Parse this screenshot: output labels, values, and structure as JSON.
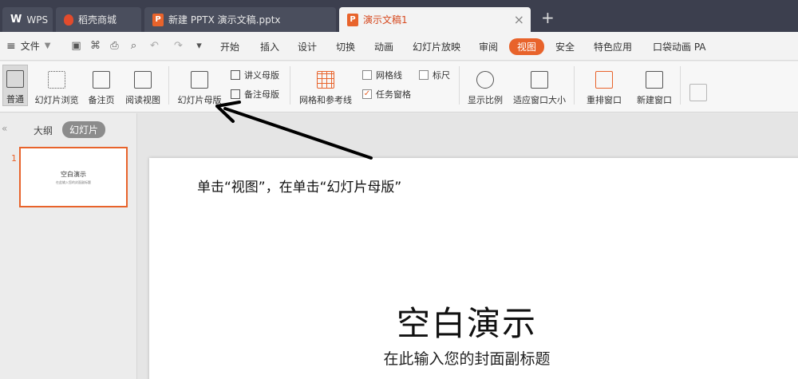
{
  "tabs": [
    {
      "label": "WPS"
    },
    {
      "label": "稻壳商城"
    },
    {
      "label": "新建 PPTX 演示文稿.pptx"
    },
    {
      "label": "演示文稿1"
    }
  ],
  "new_tab_symbol": "+",
  "menu": {
    "file": "文件",
    "items": [
      "开始",
      "插入",
      "设计",
      "切换",
      "动画",
      "幻灯片放映",
      "审阅",
      "视图",
      "安全",
      "特色应用",
      "口袋动画 PA"
    ],
    "active": "视图"
  },
  "ribbon": {
    "normal": "普通",
    "slide_sorter": "幻灯片浏览",
    "notes_page": "备注页",
    "reading_view": "阅读视图",
    "slide_master": "幻灯片母版",
    "handout_master": "讲义母版",
    "notes_master": "备注母版",
    "grid_guides": "网格和参考线",
    "gridlines": "网格线",
    "ruler": "标尺",
    "task_pane": "任务窗格",
    "zoom": "显示比例",
    "fit_window": "适应窗口大小",
    "arrange_windows": "重排窗口",
    "new_window": "新建窗口"
  },
  "left_panel": {
    "outline": "大纲",
    "slides": "幻灯片",
    "slide_number": "1",
    "thumb_title": "空白演示",
    "thumb_subtitle": "在此输入您的封面副标题"
  },
  "slide": {
    "annotation": "单击“视图”，在单击“幻灯片母版”",
    "title": "空白演示",
    "subtitle": "在此输入您的封面副标题"
  },
  "colors": {
    "accent": "#e8632b",
    "titlebar": "#3c3f4e"
  }
}
